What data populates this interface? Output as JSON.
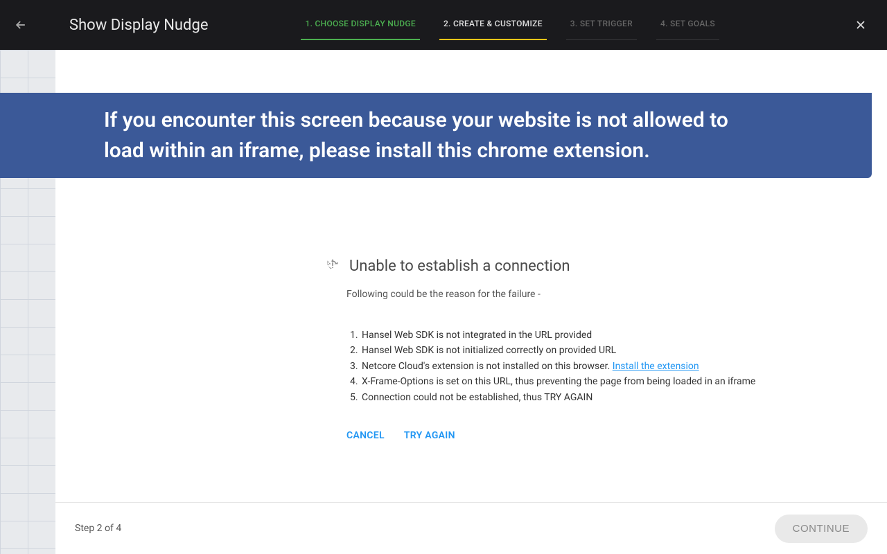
{
  "header": {
    "title": "Show Display Nudge",
    "steps": [
      {
        "label": "1. CHOOSE DISPLAY NUDGE"
      },
      {
        "label": "2. CREATE & CUSTOMIZE"
      },
      {
        "label": "3. SET TRIGGER"
      },
      {
        "label": "4. SET GOALS"
      }
    ]
  },
  "banner": {
    "text": "If you encounter this screen because your website is not allowed to load within an iframe, please install this chrome extension."
  },
  "error": {
    "title": "Unable to establish a connection",
    "subtitle": "Following could be the reason for the failure -",
    "reasons": {
      "r1": "Hansel  Web SDK is not integrated in the URL provided",
      "r2": "Hansel Web SDK is not initialized correctly on provided URL",
      "r3_prefix": "Netcore Cloud's extension is not installed on this browser. ",
      "r3_link": "Install the extension",
      "r4": "X-Frame-Options is set on this URL, thus preventing the page from being loaded in an iframe",
      "r5": "Connection could not be established, thus TRY AGAIN"
    },
    "actions": {
      "cancel": "CANCEL",
      "retry": "TRY AGAIN"
    }
  },
  "footer": {
    "step_text": "Step 2 of 4",
    "continue": "CONTINUE"
  }
}
